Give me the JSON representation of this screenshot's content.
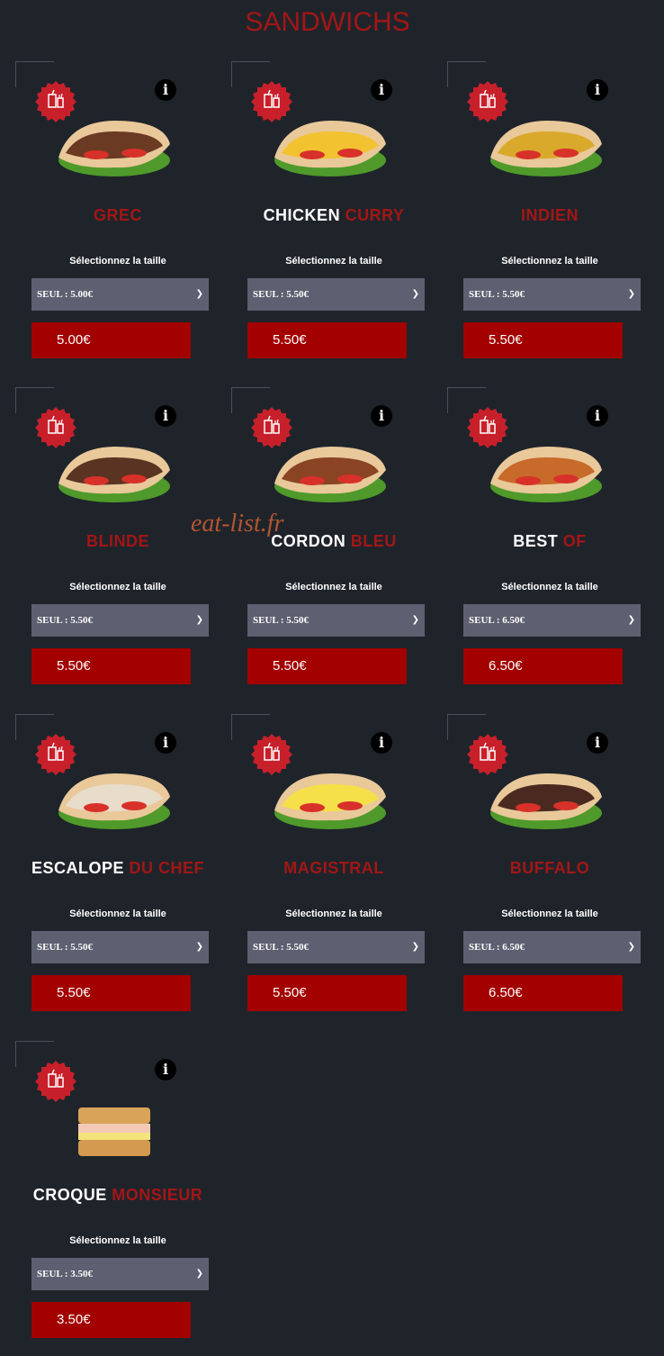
{
  "page_title": "SANDWICHS",
  "watermark": "eat-list.fr",
  "select_label": "Sélectionnez la taille",
  "colors": {
    "background": "#1f242b",
    "accent": "#a31616",
    "price_bg": "#a30000",
    "select_bg": "#5d6070"
  },
  "items": [
    {
      "name_white": "",
      "name_red": "GREC",
      "select_value": "SEUL : 5.00€",
      "price": "5.00€",
      "image": "pita-kebab"
    },
    {
      "name_white": "CHICKEN",
      "name_red": "CURRY",
      "select_value": "SEUL : 5.50€",
      "price": "5.50€",
      "image": "pita-curry"
    },
    {
      "name_white": "",
      "name_red": "INDIEN",
      "select_value": "SEUL : 5.50€",
      "price": "5.50€",
      "image": "pita-curry-steak"
    },
    {
      "name_white": "",
      "name_red": "BLINDE",
      "select_value": "SEUL : 5.50€",
      "price": "5.50€",
      "image": "pita-meat"
    },
    {
      "name_white": "CORDON",
      "name_red": "BLEU",
      "select_value": "SEUL : 5.50€",
      "price": "5.50€",
      "image": "pita-cordon-bleu"
    },
    {
      "name_white": "BEST",
      "name_red": "OF",
      "select_value": "SEUL : 6.50€",
      "price": "6.50€",
      "image": "pita-best-of"
    },
    {
      "name_white": "ESCALOPE",
      "name_red": "DU CHEF",
      "select_value": "SEUL : 5.50€",
      "price": "5.50€",
      "image": "pita-escalope"
    },
    {
      "name_white": "",
      "name_red": "MAGISTRAL",
      "select_value": "SEUL : 5.50€",
      "price": "5.50€",
      "image": "pita-egg"
    },
    {
      "name_white": "",
      "name_red": "BUFFALO",
      "select_value": "SEUL : 6.50€",
      "price": "6.50€",
      "image": "pita-buffalo"
    },
    {
      "name_white": "CROQUE",
      "name_red": "MONSIEUR",
      "select_value": "SEUL : 3.50€",
      "price": "3.50€",
      "image": "croque-monsieur"
    }
  ]
}
